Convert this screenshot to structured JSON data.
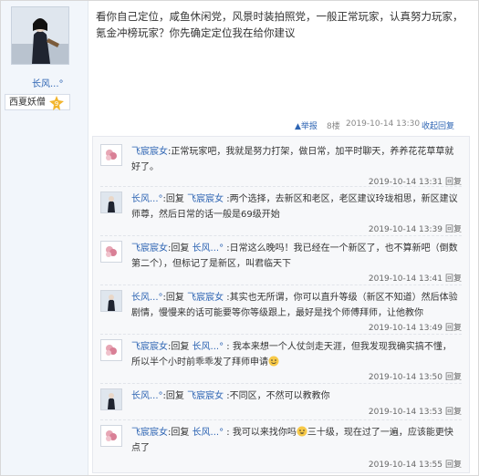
{
  "author": {
    "name": "长风...°",
    "badge_label": "西夏妖僧",
    "badge_level": "9"
  },
  "post": {
    "text": "看你自己定位，咸鱼休闲党，风景时装拍照党，一般正常玩家，认真努力玩家，氪金冲榜玩家？你先确定定位我在给你建议",
    "report_label": "举报",
    "floor": "8楼",
    "time": "2019-10-14 13:30",
    "collapse_label": "收起回复"
  },
  "replies": [
    {
      "name": "飞宸宸女",
      "sep": ":",
      "text": "正常玩家吧，我就是努力打架，做日常，加平时聊天，养养花花草草就好了。",
      "time": "2019-10-14 13:31",
      "reply": "回复"
    },
    {
      "name": "长风...°",
      "sep": ":",
      "prefix": "回复 ",
      "target": "飞宸宸女",
      "text": " :两个选择，去新区和老区，老区建议玲珑相思，新区建议师尊，然后日常的话一般是69级开始",
      "time": "2019-10-14 13:39",
      "reply": "回复"
    },
    {
      "name": "飞宸宸女",
      "sep": ":",
      "prefix": "回复 ",
      "target": "长风...°",
      "text": " :日常这么晚吗！我已经在一个新区了，也不算新吧（倒数第二个），但标记了是新区，叫君临天下",
      "time": "2019-10-14 13:41",
      "reply": "回复"
    },
    {
      "name": "长风...°",
      "sep": ":",
      "prefix": "回复 ",
      "target": "飞宸宸女",
      "text": " :其实也无所谓，你可以直升等级（新区不知道）然后体验剧情，慢慢来的话可能要等你等级跟上，最好是找个师傅拜师，让他教你",
      "time": "2019-10-14 13:49",
      "reply": "回复"
    },
    {
      "name": "飞宸宸女",
      "sep": ":",
      "prefix": "回复 ",
      "target": "长风...°",
      "text": " : 我本来想一个人仗剑走天涯，但我发现我确实搞不懂，所以半个小时前乖乖发了拜师申请",
      "time": "2019-10-14 13:50",
      "reply": "回复"
    },
    {
      "name": "长风...°",
      "sep": ":",
      "prefix": "回复 ",
      "target": "飞宸宸女",
      "text": " :不同区，不然可以教教你",
      "time": "2019-10-14 13:53",
      "reply": "回复"
    },
    {
      "name": "飞宸宸女",
      "sep": ":",
      "prefix": "回复 ",
      "target": "长风...°",
      "text": " : 我可以来找你吗",
      "text2": "三十级，现在过了一遍，应该能更快点了",
      "time": "2019-10-14 13:55",
      "reply": "回复"
    }
  ]
}
